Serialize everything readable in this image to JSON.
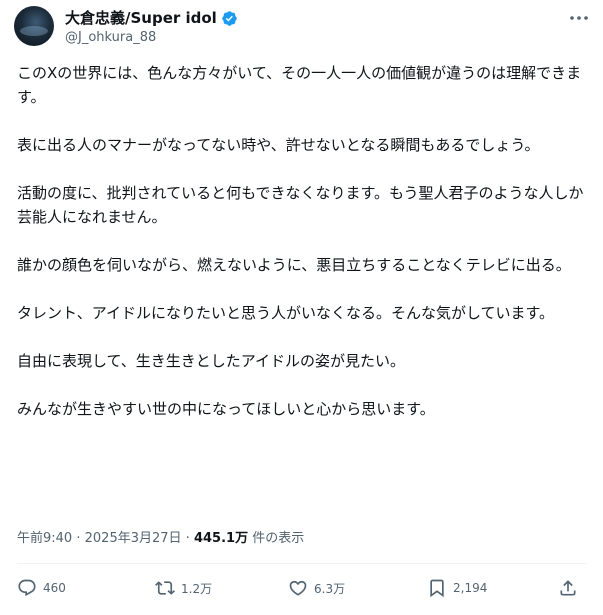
{
  "author": {
    "display_name": "大倉忠義/Super idol",
    "handle": "@J_ohkura_88"
  },
  "icons": {
    "verified": "verified-badge-icon",
    "more": "more-options-icon",
    "reply": "reply-icon",
    "repost": "repost-icon",
    "like": "like-icon",
    "bookmark": "bookmark-icon",
    "share": "share-icon"
  },
  "colors": {
    "verified": "#1d9bf0",
    "text": "#0f1419",
    "muted": "#536471"
  },
  "post": {
    "paragraphs": [
      "このXの世界には、色んな方々がいて、その一人一人の価値観が違うのは理解できます。",
      "表に出る人のマナーがなってない時や、許せないとなる瞬間もあるでしょう。",
      "活動の度に、批判されていると何もできなくなります。もう聖人君子のような人しか芸能人になれません。",
      "誰かの顔色を伺いながら、燃えないように、悪目立ちすることなくテレビに出る。",
      "タレント、アイドルになりたいと思う人がいなくなる。そんな気がしています。",
      "自由に表現して、生き生きとしたアイドルの姿が見たい。",
      "みんなが生きやすい世の中になってほしいと心から思います。"
    ],
    "time": "午前9:40",
    "separator": "·",
    "date": "2025年3月27日",
    "views": "445.1万",
    "views_label": "件の表示"
  },
  "actions": {
    "replies": "460",
    "reposts": "1.2万",
    "likes": "6.3万",
    "bookmarks": "2,194"
  }
}
